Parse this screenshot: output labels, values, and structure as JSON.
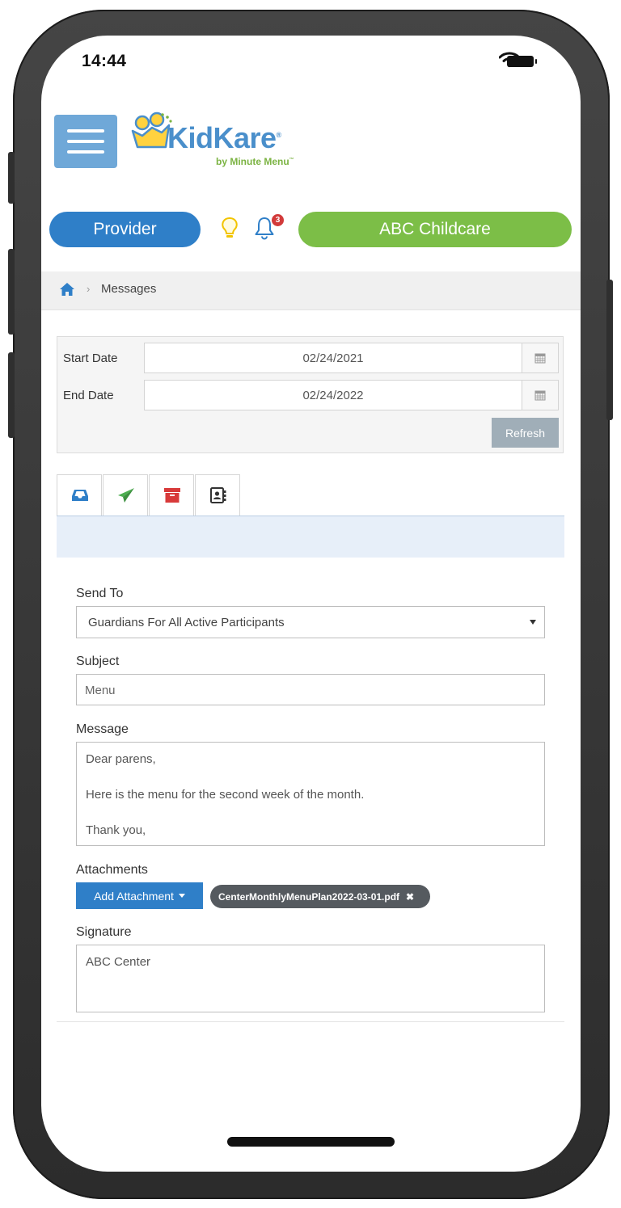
{
  "status_bar": {
    "time": "14:44"
  },
  "header": {
    "logo": {
      "name": "KidKare",
      "registered": "®",
      "tagline": "by Minute Menu",
      "tagline_mark": "™"
    },
    "role_button": "Provider",
    "notification_count": "3",
    "center_button": "ABC Childcare"
  },
  "breadcrumb": {
    "separator": "›",
    "current": "Messages"
  },
  "filters": {
    "start_label": "Start Date",
    "start_value": "02/24/2021",
    "end_label": "End Date",
    "end_value": "02/24/2022",
    "refresh_label": "Refresh"
  },
  "tabs": [
    {
      "icon": "inbox-icon",
      "color": "#2f7fc8"
    },
    {
      "icon": "paper-plane-icon",
      "color": "#4caf50"
    },
    {
      "icon": "archive-icon",
      "color": "#d83a3a"
    },
    {
      "icon": "contacts-icon",
      "color": "#333333"
    }
  ],
  "form": {
    "send_to_label": "Send To",
    "send_to_value": "Guardians For All Active Participants",
    "subject_label": "Subject",
    "subject_value": "Menu",
    "message_label": "Message",
    "message_lines": [
      "Dear parens,",
      "Here is the menu for the second week of the month.",
      "Thank you,"
    ],
    "attachments_label": "Attachments",
    "add_attachment_label": "Add Attachment",
    "attachment_file": "CenterMonthlyMenuPlan2022-03-01.pdf",
    "attachment_remove": "✖",
    "signature_label": "Signature",
    "signature_value": "ABC Center"
  },
  "colors": {
    "primary_blue": "#2f7fc8",
    "green": "#7cbe47",
    "menu_blue": "#6fa8d8"
  }
}
